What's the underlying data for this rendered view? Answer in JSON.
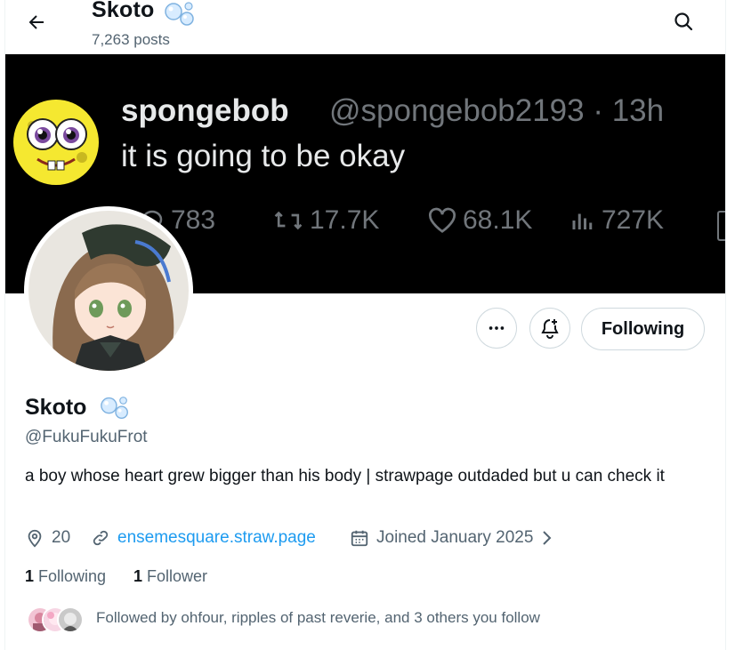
{
  "header": {
    "name": "Skoto",
    "posts": "7,263 posts"
  },
  "banner": {
    "tweet_name": "spongebob",
    "tweet_handle_time": "@spongebob2193 · 13h",
    "tweet_text": "it is going to be okay",
    "metrics": {
      "replies": "783",
      "reposts": "17.7K",
      "likes": "68.1K",
      "views": "727K"
    }
  },
  "actions": {
    "following_label": "Following"
  },
  "profile": {
    "name": "Skoto",
    "handle": "@FukuFukuFrot",
    "bio": "a boy whose heart grew bigger than his body | strawpage outdaded but u can check it",
    "location": "20",
    "link": "ensemesquare.straw.page",
    "joined": "Joined January 2025",
    "following_count": "1",
    "following_label": "Following",
    "follower_count": "1",
    "follower_label": "Follower",
    "followed_by": "Followed by ohfour, ripples of past reverie, and 3 others you follow"
  },
  "colors": {
    "link": "#1d9bf0",
    "secondary_text": "#536471",
    "primary_text": "#0f1419",
    "banner_bg": "#000000"
  }
}
